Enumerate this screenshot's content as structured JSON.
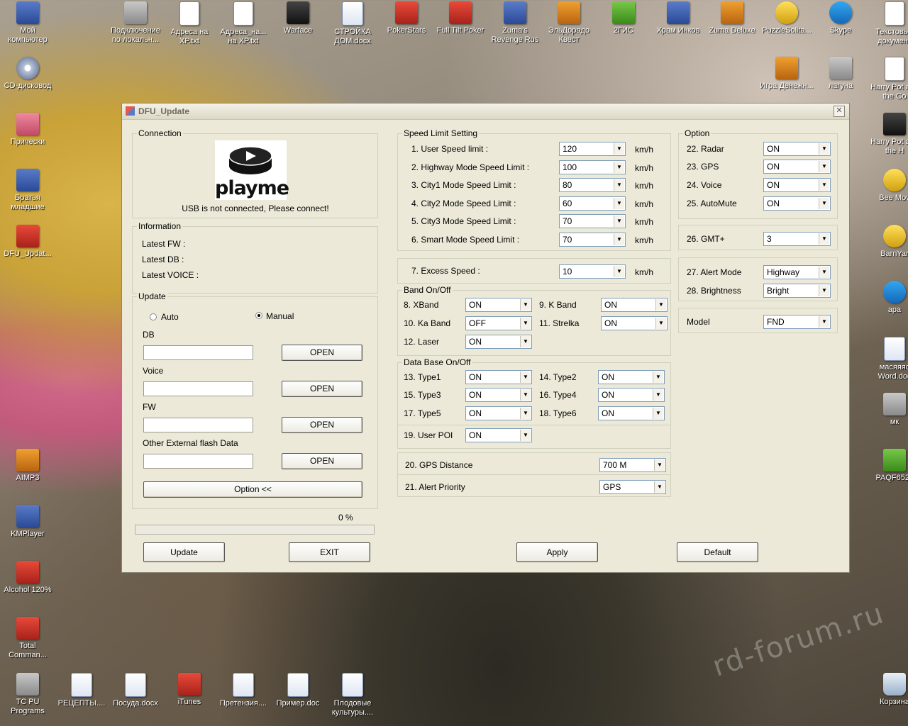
{
  "desktop": {
    "icons": [
      {
        "label": "Мой компьютер",
        "kind": "app"
      },
      {
        "label": "Подключение по локальн...",
        "kind": "gray"
      },
      {
        "label": "Адреса на XP.txt",
        "kind": "txt"
      },
      {
        "label": "Адреса_на... на XP.txt",
        "kind": "txt"
      },
      {
        "label": "Warface",
        "kind": "dark"
      },
      {
        "label": "СТРОЙКА ДОМ.docx",
        "kind": "doc"
      },
      {
        "label": "PokerStars",
        "kind": "red"
      },
      {
        "label": "Full Tilt Poker",
        "kind": "red"
      },
      {
        "label": "Zuma's Revenge Rus",
        "kind": "app"
      },
      {
        "label": "ЭльДорадо Квест",
        "kind": "orange"
      },
      {
        "label": "2ГИС",
        "kind": "green"
      },
      {
        "label": "Храм Инков",
        "kind": "app"
      },
      {
        "label": "Zuma Deluxe",
        "kind": "orange"
      },
      {
        "label": "PuzzleSolita...",
        "kind": "yellow"
      },
      {
        "label": "Skype",
        "kind": "blue"
      },
      {
        "label": "Текстовый документ",
        "kind": "txt"
      },
      {
        "label": "CD-дисковод",
        "kind": "cd"
      },
      {
        "label": "Прически",
        "kind": "pink"
      },
      {
        "label": "Братья младшие",
        "kind": "app"
      },
      {
        "label": "DFU_Updat...",
        "kind": "red"
      },
      {
        "label": "Игра Денежн...",
        "kind": "orange"
      },
      {
        "label": "лагуна",
        "kind": "gray"
      },
      {
        "label": "Harry Pot and the Go",
        "kind": "txt"
      },
      {
        "label": "Harry Pot and the H",
        "kind": "dark"
      },
      {
        "label": "Bee Mov",
        "kind": "yellow"
      },
      {
        "label": "BarnYar",
        "kind": "yellow"
      },
      {
        "label": "apa",
        "kind": "blue"
      },
      {
        "label": "масяяяс Word.doc",
        "kind": "doc"
      },
      {
        "label": "мк",
        "kind": "gray"
      },
      {
        "label": "PAQF652s",
        "kind": "green"
      },
      {
        "label": "AIMP3",
        "kind": "orange"
      },
      {
        "label": "KMPlayer",
        "kind": "app"
      },
      {
        "label": "Alcohol 120%",
        "kind": "red"
      },
      {
        "label": "Total Comman...",
        "kind": "red"
      },
      {
        "label": "TC PU Programs",
        "kind": "gray"
      },
      {
        "label": "РЕЦЕПТЫ....",
        "kind": "doc"
      },
      {
        "label": "Посуда.docx",
        "kind": "doc"
      },
      {
        "label": "iTunes",
        "kind": "red"
      },
      {
        "label": "Претензия....",
        "kind": "doc"
      },
      {
        "label": "Пример.doc",
        "kind": "doc"
      },
      {
        "label": "Плодовые культуры....",
        "kind": "doc"
      },
      {
        "label": "Корзина",
        "kind": "bin"
      }
    ],
    "watermark": "rd-forum.ru"
  },
  "window": {
    "title": "DFU_Update",
    "close_glyph": "✕"
  },
  "connection": {
    "legend": "Connection",
    "logo_text": "playme",
    "status": "USB is not connected, Please connect!"
  },
  "information": {
    "legend": "Information",
    "latest_fw": "Latest FW :",
    "latest_db": "Latest DB :",
    "latest_voice": "Latest VOICE :"
  },
  "update": {
    "legend": "Update",
    "auto": "Auto",
    "manual": "Manual",
    "mode": "manual",
    "db_label": "DB",
    "voice_label": "Voice",
    "fw_label": "FW",
    "other_label": "Other External flash Data",
    "open": "OPEN",
    "option": "Option <<",
    "progress_text": "0 %",
    "progress": 0
  },
  "speed": {
    "legend": "Speed Limit Setting",
    "unit": "km/h",
    "rows": [
      {
        "label": "1. User Speed limit :",
        "value": "120"
      },
      {
        "label": "2. Highway Mode Speed Limit :",
        "value": "100"
      },
      {
        "label": "3. City1 Mode Speed Limit :",
        "value": "80"
      },
      {
        "label": "4. City2 Mode Speed Limit :",
        "value": "60"
      },
      {
        "label": "5. City3 Mode Speed Limit :",
        "value": "70"
      },
      {
        "label": "6. Smart Mode Speed Limit :",
        "value": "70"
      }
    ],
    "excess_label": "7. Excess Speed :",
    "excess_value": "10"
  },
  "band": {
    "legend": "Band On/Off",
    "xband": {
      "label": "8. XBand",
      "value": "ON"
    },
    "kband": {
      "label": "9. K Band",
      "value": "ON"
    },
    "kaband": {
      "label": "10. Ka Band",
      "value": "OFF"
    },
    "strelka": {
      "label": "11. Strelka",
      "value": "ON"
    },
    "laser": {
      "label": "12. Laser",
      "value": "ON"
    }
  },
  "database": {
    "legend": "Data Base On/Off",
    "type1": {
      "label": "13. Type1",
      "value": "ON"
    },
    "type2": {
      "label": "14. Type2",
      "value": "ON"
    },
    "type3": {
      "label": "15. Type3",
      "value": "ON"
    },
    "type4": {
      "label": "16. Type4",
      "value": "ON"
    },
    "type5": {
      "label": "17. Type5",
      "value": "ON"
    },
    "type6": {
      "label": "18. Type6",
      "value": "ON"
    },
    "userpoi": {
      "label": "19. User POI",
      "value": "ON"
    }
  },
  "gps": {
    "distance": {
      "label": "20. GPS Distance",
      "value": "700 M"
    },
    "priority": {
      "label": "21. Alert Priority",
      "value": "GPS"
    }
  },
  "option": {
    "legend": "Option",
    "radar": {
      "label": "22. Radar",
      "value": "ON"
    },
    "gps": {
      "label": "23. GPS",
      "value": "ON"
    },
    "voice": {
      "label": "24. Voice",
      "value": "ON"
    },
    "automute": {
      "label": "25. AutoMute",
      "value": "ON"
    },
    "gmt": {
      "label": "26. GMT+",
      "value": "3"
    },
    "alertmode": {
      "label": "27. Alert Mode",
      "value": "Highway"
    },
    "brightness": {
      "label": "28. Brightness",
      "value": "Bright"
    },
    "model": {
      "label": "Model",
      "value": "FND"
    }
  },
  "buttons": {
    "update": "Update",
    "exit": "EXIT",
    "apply": "Apply",
    "default": "Default"
  },
  "glyphs": {
    "arrow": "▼"
  }
}
